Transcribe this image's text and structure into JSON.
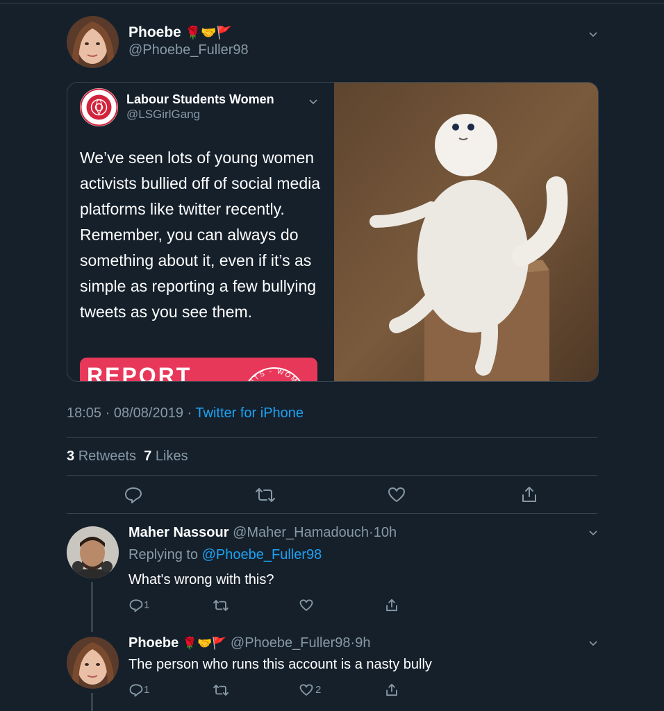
{
  "main_tweet": {
    "author_name": "Phoebe",
    "author_emoji": "🌹🤝🚩",
    "author_handle": "@Phoebe_Fuller98",
    "quoted": {
      "author_name": "Labour Students Women",
      "author_handle": "@LSGirlGang",
      "text": "We’ve seen lots of young women activists bullied off of social media platforms like twitter recently. Remember, you can always do something about it, even if it’s as simple as reporting a few bullying tweets as you see them.",
      "banner_text": "REPORT",
      "banner_logo_text": "ENTS - WOM",
      "logo_text": "STUDENTS WOMEN"
    },
    "time": "18:05",
    "date": "08/08/2019",
    "source": "Twitter for iPhone",
    "separator": "·",
    "retweets_count": "3",
    "retweets_label": "Retweets",
    "likes_count": "7",
    "likes_label": "Likes"
  },
  "replies": [
    {
      "author_name": "Maher Nassour",
      "author_handle": "@Maher_Hamadouch",
      "time": "10h",
      "replying_prefix": "Replying to",
      "replying_to": "@Phoebe_Fuller98",
      "text": "What's wrong with this?",
      "reply_count": "1",
      "retweet_count": "",
      "like_count": ""
    },
    {
      "author_name": "Phoebe",
      "author_emoji": "🌹🤝🚩",
      "author_handle": "@Phoebe_Fuller98",
      "time": "9h",
      "text": "The person who runs this account is a nasty bully",
      "reply_count": "1",
      "retweet_count": "",
      "like_count": "2"
    }
  ],
  "colors": {
    "background": "#15202b",
    "accent": "#1da1f2",
    "muted": "#8899a6",
    "divider": "#38444d",
    "report_banner": "#e8385a"
  },
  "icons": [
    "reply-icon",
    "retweet-icon",
    "like-icon",
    "share-icon",
    "chevron-down-icon"
  ]
}
